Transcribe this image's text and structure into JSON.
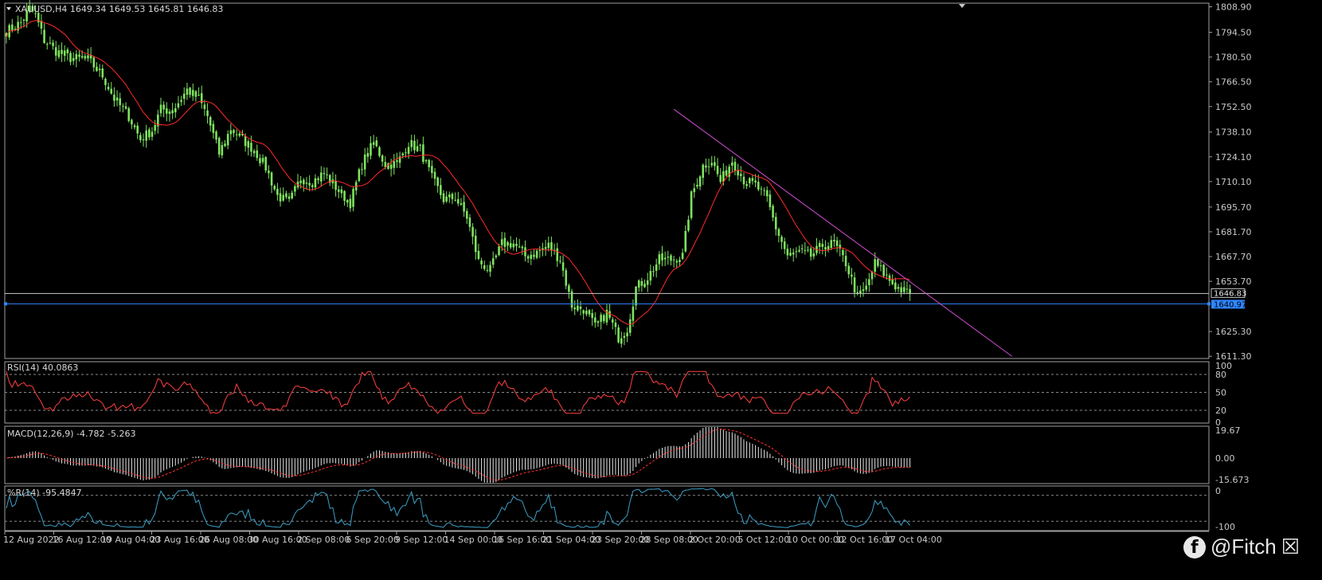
{
  "colors": {
    "background": "#000000",
    "frame": "#a0a0a0",
    "candle": "#7fe25f",
    "ma": "#ff2a2a",
    "trendline": "#d24fd2",
    "bid_line": "#c8c8c8",
    "support_line": "#2f86ff",
    "rsi": "#ff4040",
    "macd_hist": "#e8e8e8",
    "macd_signal": "#ff3030",
    "wpr": "#3ca0c8"
  },
  "chart_data": [
    {
      "type": "candlestick",
      "title": "XAUUSD,H4  1649.34 1649.53 1645.81 1646.83",
      "symbol": "XAUUSD",
      "timeframe": "H4",
      "ohlc_last": {
        "open": 1649.34,
        "high": 1649.53,
        "low": 1645.81,
        "close": 1646.83
      },
      "x_ticks": [
        "12 Aug 2022",
        "16 Aug 12:00",
        "19 Aug 04:00",
        "23 Aug 16:00",
        "26 Aug 08:00",
        "30 Aug 16:00",
        "2 Sep 08:00",
        "6 Sep 20:00",
        "9 Sep 12:00",
        "14 Sep 00:00",
        "16 Sep 16:00",
        "21 Sep 04:00",
        "23 Sep 20:00",
        "28 Sep 08:00",
        "2 Oct 20:00",
        "5 Oct 12:00",
        "10 Oct 00:00",
        "12 Oct 16:00",
        "17 Oct 04:00"
      ],
      "y_ticks": [
        1808.9,
        1794.5,
        1780.5,
        1766.5,
        1752.5,
        1738.1,
        1724.1,
        1710.1,
        1695.7,
        1681.7,
        1667.7,
        1653.7,
        1625.3,
        1611.3
      ],
      "ylim": [
        1610.5,
        1810.5
      ],
      "price_labels": {
        "bid": "1646.83",
        "support": "1640.97"
      },
      "horizontal_lines": [
        1646.83,
        1640.97
      ],
      "trendline": {
        "from": {
          "bar": 229,
          "price": 1751.0
        },
        "to": {
          "bar": 345,
          "price": 1611.3
        }
      },
      "moving_average": true,
      "anchors": [
        [
          0,
          1795
        ],
        [
          5,
          1800
        ],
        [
          8,
          1808
        ],
        [
          10,
          1804
        ],
        [
          13,
          1790
        ],
        [
          17,
          1784
        ],
        [
          22,
          1780
        ],
        [
          28,
          1779
        ],
        [
          33,
          1770
        ],
        [
          37,
          1757
        ],
        [
          42,
          1747
        ],
        [
          46,
          1734
        ],
        [
          50,
          1739
        ],
        [
          53,
          1751
        ],
        [
          57,
          1750
        ],
        [
          62,
          1762
        ],
        [
          66,
          1757
        ],
        [
          69,
          1747
        ],
        [
          73,
          1726
        ],
        [
          77,
          1740
        ],
        [
          81,
          1734
        ],
        [
          85,
          1728
        ],
        [
          89,
          1718
        ],
        [
          93,
          1702
        ],
        [
          97,
          1698
        ],
        [
          101,
          1712
        ],
        [
          105,
          1710
        ],
        [
          109,
          1715
        ],
        [
          114,
          1705
        ],
        [
          118,
          1698
        ],
        [
          122,
          1720
        ],
        [
          126,
          1732
        ],
        [
          130,
          1720
        ],
        [
          134,
          1720
        ],
        [
          138,
          1732
        ],
        [
          142,
          1728
        ],
        [
          146,
          1712
        ],
        [
          150,
          1700
        ],
        [
          154,
          1701
        ],
        [
          158,
          1690
        ],
        [
          162,
          1665
        ],
        [
          166,
          1660
        ],
        [
          170,
          1675
        ],
        [
          174,
          1675
        ],
        [
          178,
          1668
        ],
        [
          182,
          1670
        ],
        [
          186,
          1674
        ],
        [
          190,
          1666
        ],
        [
          194,
          1640
        ],
        [
          198,
          1638
        ],
        [
          202,
          1628
        ],
        [
          206,
          1636
        ],
        [
          210,
          1622
        ],
        [
          213,
          1627
        ],
        [
          216,
          1650
        ],
        [
          220,
          1656
        ],
        [
          224,
          1666
        ],
        [
          228,
          1666
        ],
        [
          232,
          1668
        ],
        [
          235,
          1702
        ],
        [
          239,
          1719
        ],
        [
          242,
          1722
        ],
        [
          245,
          1710
        ],
        [
          249,
          1722
        ],
        [
          253,
          1711
        ],
        [
          257,
          1708
        ],
        [
          261,
          1700
        ],
        [
          264,
          1684
        ],
        [
          268,
          1668
        ],
        [
          272,
          1670
        ],
        [
          276,
          1668
        ],
        [
          280,
          1674
        ],
        [
          284,
          1675
        ],
        [
          288,
          1664
        ],
        [
          292,
          1645
        ],
        [
          295,
          1650
        ],
        [
          298,
          1664
        ],
        [
          302,
          1656
        ],
        [
          305,
          1651
        ],
        [
          308,
          1648
        ],
        [
          310,
          1646.8
        ]
      ],
      "bar_count": 311
    },
    {
      "type": "line",
      "title": "RSI(14) 40.0863",
      "y_ticks": [
        100,
        80,
        50,
        20,
        0
      ],
      "ylim": [
        0,
        100
      ],
      "levels": [
        80,
        50,
        20
      ]
    },
    {
      "type": "bar",
      "title": "MACD(12,26,9) -4.782 -5.263",
      "y_ticks": [
        "19.67",
        "0.00",
        "-15.673"
      ],
      "ylim": [
        -15.673,
        19.67
      ]
    },
    {
      "type": "line",
      "title": "%R(14) -95.4847",
      "y_ticks": [
        0,
        -100
      ],
      "ylim": [
        -100,
        0
      ],
      "levels": [
        -20,
        -80
      ]
    }
  ],
  "watermark": {
    "icon": "facebook-icon",
    "text": "@Fitch",
    "trailing": "☒"
  }
}
